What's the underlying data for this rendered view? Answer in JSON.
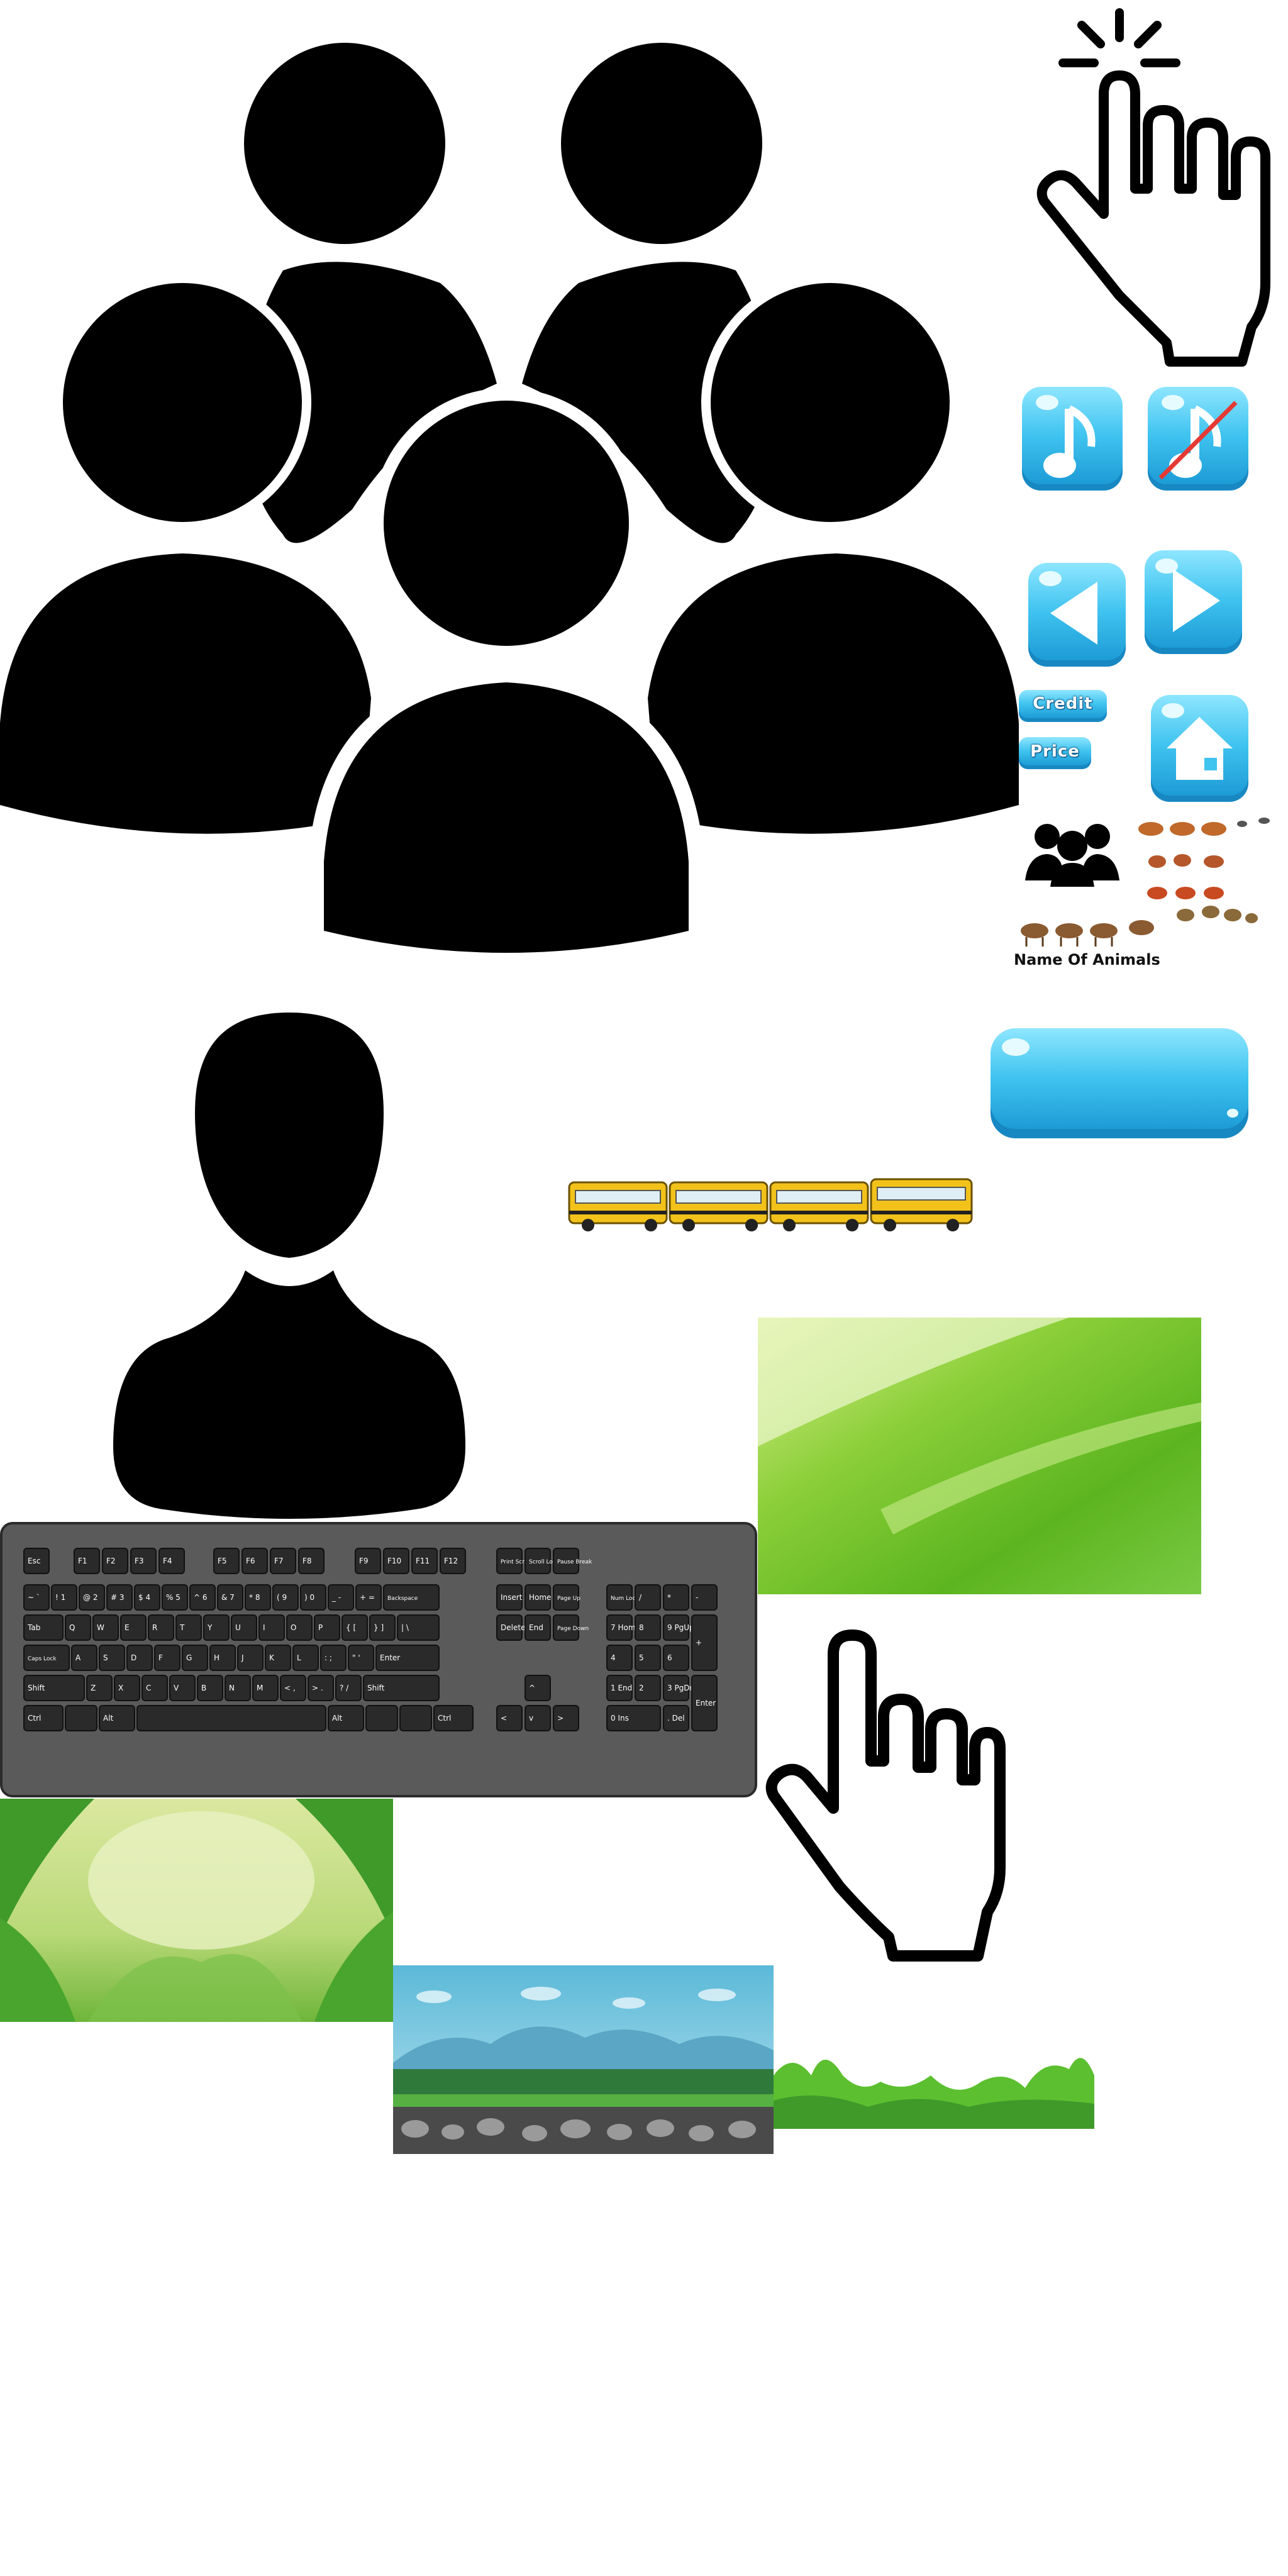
{
  "sheet": {
    "labels": {
      "credit": "Credit",
      "price": "Price",
      "name_of_animals": "Name Of Animals"
    },
    "keyboard": {
      "rows": [
        [
          "Esc",
          "F1",
          "F2",
          "F3",
          "F4",
          "F5",
          "F6",
          "F7",
          "F8",
          "F9",
          "F10",
          "F11",
          "F12",
          "Print Scr SysRq",
          "Scroll Lock",
          "Pause Break"
        ],
        [
          "~ `",
          "! 1",
          "@ 2",
          "# 3",
          "$ 4",
          "% 5",
          "^ 6",
          "& 7",
          "* 8",
          "( 9",
          ") 0",
          "_ -",
          "+ =",
          "Backspace"
        ],
        [
          "Tab",
          "Q",
          "W",
          "E",
          "R",
          "T",
          "Y",
          "U",
          "I",
          "O",
          "P",
          "{ [",
          "} ]",
          "| \\"
        ],
        [
          "Caps Lock",
          "A",
          "S",
          "D",
          "F",
          "G",
          "H",
          "J",
          "K",
          "L",
          ": ;",
          "\" '",
          "Enter"
        ],
        [
          "Shift",
          "Z",
          "X",
          "C",
          "V",
          "B",
          "N",
          "M",
          "< ,",
          "> .",
          "? /",
          "Shift"
        ],
        [
          "Ctrl",
          "",
          "Alt",
          "",
          "Alt",
          "",
          "",
          "Ctrl"
        ]
      ],
      "nav_keys": [
        "Insert",
        "Home",
        "Page Up",
        "Delete",
        "End",
        "Page Down"
      ],
      "numpad_keys": [
        "Num Lock",
        "/",
        "*",
        "-",
        "7 Home",
        "8",
        "9 PgUp",
        "+",
        "4",
        "5",
        "6",
        "1 End",
        "2",
        "3 PgDn",
        "Enter",
        "0 Ins",
        ". Del"
      ]
    },
    "icon_names": [
      "group-of-five-people-icon",
      "single-person-icon",
      "tapping-hand-cursor-icon",
      "pointing-hand-cursor-icon",
      "music-on-button-icon",
      "music-off-button-icon",
      "previous-arrow-button-icon",
      "next-arrow-button-icon",
      "home-button-icon",
      "small-people-group-icon",
      "computer-keyboard-icon"
    ],
    "colors": {
      "button_blue": "#3fc3ef",
      "button_blue_dark": "#1d9bd6",
      "button_highlight": "#b9f0ff",
      "grass_green": "#7ac943",
      "bus_yellow": "#f2c21a",
      "keyboard_body": "#5a5a5a",
      "key_face": "#2a2a2a",
      "icon_black": "#000000"
    }
  }
}
